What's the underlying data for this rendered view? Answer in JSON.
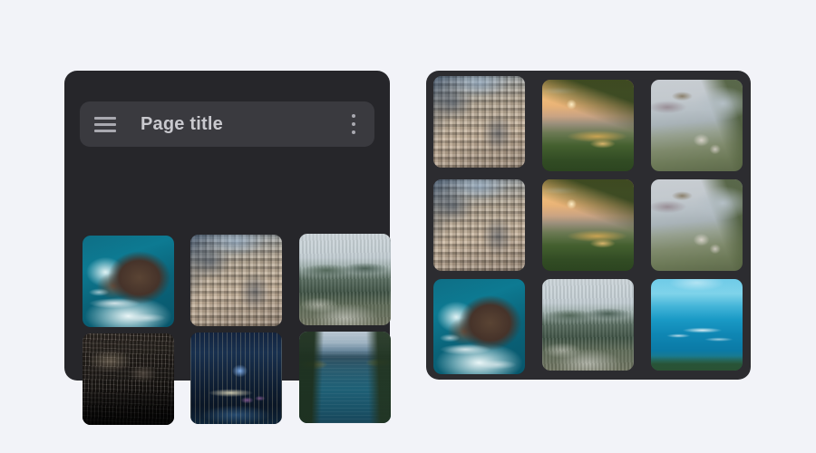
{
  "theme": {
    "page_background": "#f2f3f8",
    "left_card_background": "#26262a",
    "right_card_background": "#2c2c30",
    "appbar_background": "#3a3a3f",
    "icon_color": "#a9a9b0",
    "title_color": "#c9c9ce"
  },
  "left_panel": {
    "name": "image-gallery-card",
    "appbar": {
      "menu_icon": "hamburger-menu-icon",
      "title": "Page title",
      "overflow_icon": "kebab-menu-icon"
    },
    "gallery": {
      "columns": 3,
      "rows": 2,
      "tiles": [
        {
          "index": 1,
          "alt": "Aerial view of rocky headland with turquoise surf",
          "scene": "cliff"
        },
        {
          "index": 2,
          "alt": "Dense daytime city skyline from above",
          "scene": "city-day"
        },
        {
          "index": 3,
          "alt": "Green hills above a coastal town",
          "scene": "hills"
        },
        {
          "index": 4,
          "alt": "Dark aerial view of a dense city at dusk",
          "scene": "city-dark"
        },
        {
          "index": 5,
          "alt": "Illuminated waterfront city at night",
          "scene": "city-night"
        },
        {
          "index": 6,
          "alt": "Forested lake channel at dawn",
          "scene": "lake"
        }
      ]
    }
  },
  "right_panel": {
    "name": "image-grid-card",
    "gallery": {
      "columns": 3,
      "rows": 3,
      "tiles": [
        {
          "index": 1,
          "alt": "Dense daytime city skyline from above",
          "scene": "city-day"
        },
        {
          "index": 2,
          "alt": "Sunset over a valley seen from a green ridge",
          "scene": "sunset"
        },
        {
          "index": 3,
          "alt": "Coastal bay with rocks and a sandy path",
          "scene": "coast"
        },
        {
          "index": 4,
          "alt": "Dense daytime city skyline from above",
          "scene": "city-day"
        },
        {
          "index": 5,
          "alt": "Sunset over a valley seen from a green ridge",
          "scene": "sunset"
        },
        {
          "index": 6,
          "alt": "Coastal bay with rocks and a sandy path",
          "scene": "coast"
        },
        {
          "index": 7,
          "alt": "Aerial view of rocky headland with turquoise surf",
          "scene": "cliff"
        },
        {
          "index": 8,
          "alt": "Green hills above a coastal town",
          "scene": "hills"
        },
        {
          "index": 9,
          "alt": "Turquoise tropical sea with reef break",
          "scene": "tropical"
        }
      ]
    }
  }
}
